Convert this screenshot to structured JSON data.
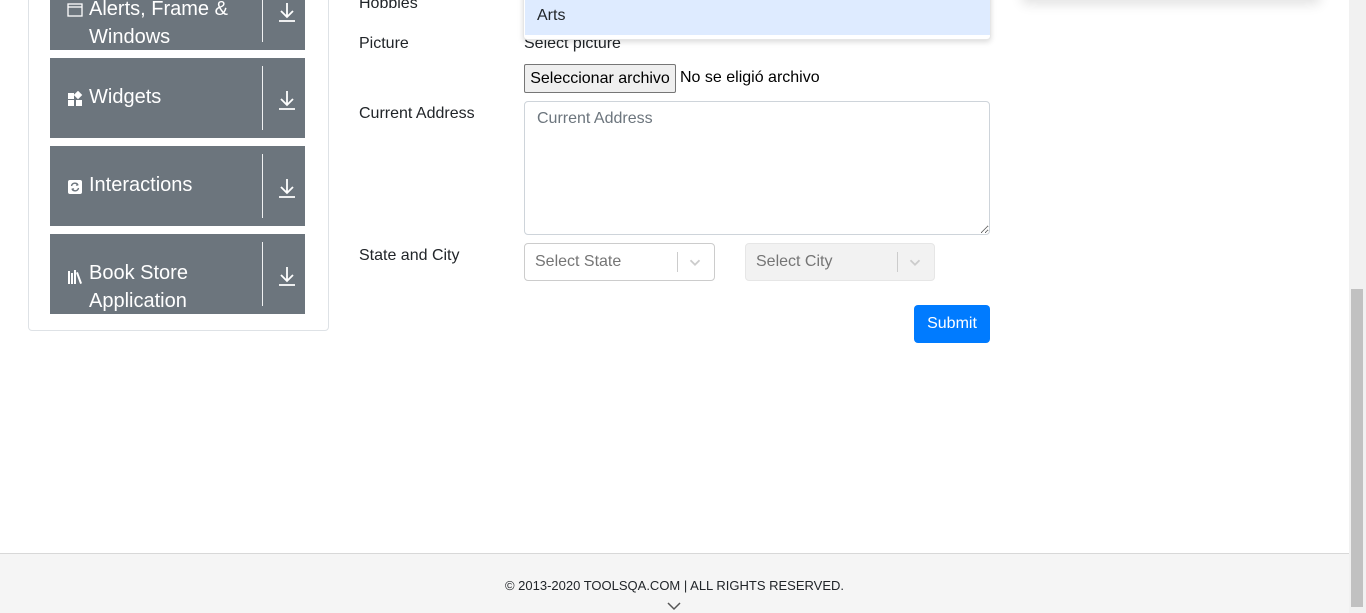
{
  "sidebar": {
    "groups": [
      {
        "label_line1": "Alerts, Frame &",
        "label_line2": "Windows",
        "icon": "window-icon"
      },
      {
        "label": "Widgets",
        "icon": "widgets-icon"
      },
      {
        "label": "Interactions",
        "icon": "interactions-icon"
      },
      {
        "label_line1": "Book Store",
        "label_line2": "Application",
        "icon": "book-store-icon"
      }
    ]
  },
  "form": {
    "hobbies_label": "Hobbies",
    "dropdown_option": "Arts",
    "picture_label": "Picture",
    "picture_hint": "Select picture",
    "file_button": "Seleccionar archivo",
    "file_status": "No se eligió archivo",
    "address_label": "Current Address",
    "address_placeholder": "Current Address",
    "state_city_label": "State and City",
    "state_placeholder": "Select State",
    "city_placeholder": "Select City",
    "submit_label": "Submit"
  },
  "footer": {
    "copyright": "© 2013-2020 TOOLSQA.COM | ALL RIGHTS RESERVED."
  },
  "colors": {
    "sidebar_bg": "#6c757d",
    "primary": "#007bff",
    "option_highlight": "#deebff"
  }
}
